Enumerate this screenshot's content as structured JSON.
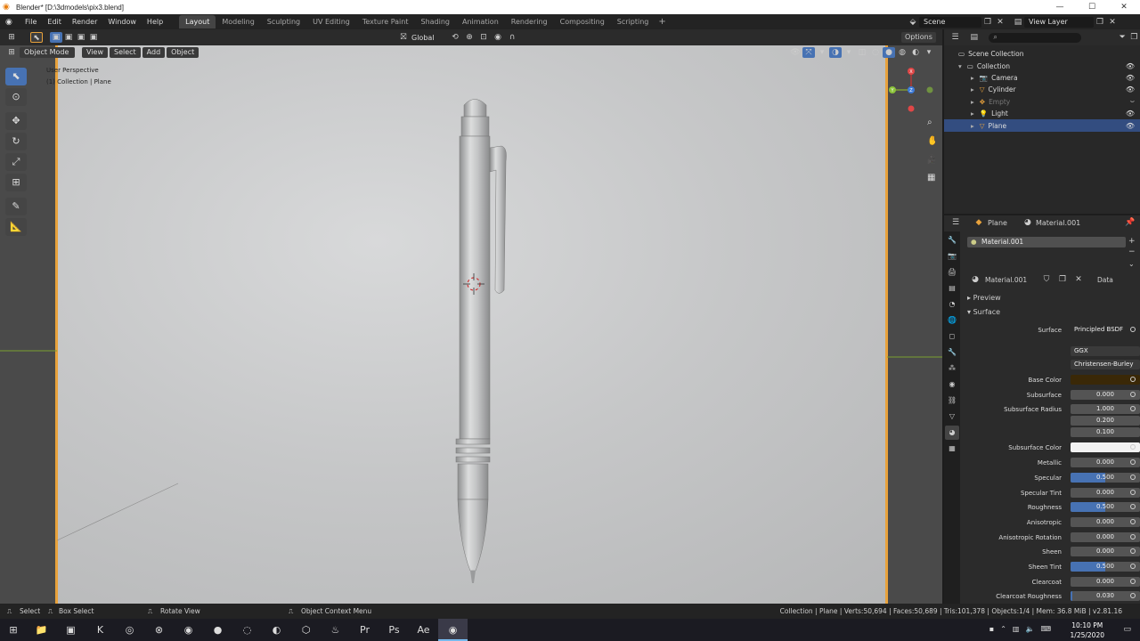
{
  "window": {
    "title": "Blender* [D:\\3dmodels\\pix3.blend]",
    "controls": [
      "—",
      "☐",
      "✕"
    ]
  },
  "menubar": {
    "items": [
      "File",
      "Edit",
      "Render",
      "Window",
      "Help"
    ],
    "workspaces": [
      "Layout",
      "Modeling",
      "Sculpting",
      "UV Editing",
      "Texture Paint",
      "Shading",
      "Animation",
      "Rendering",
      "Compositing",
      "Scripting"
    ],
    "active_workspace": "Layout",
    "scene": "Scene",
    "view_layer": "View Layer"
  },
  "header": {
    "transform_orientation": "Global",
    "options_label": "Options"
  },
  "viewport": {
    "mode": "Object Mode",
    "menus": [
      "View",
      "Select",
      "Add",
      "Object"
    ],
    "info_line1": "User Perspective",
    "info_line2": "(1) Collection | Plane",
    "gizmo_axes": {
      "x": "X",
      "y": "Y",
      "z": "Z"
    }
  },
  "outliner": {
    "root": "Scene Collection",
    "collection": "Collection",
    "objects": [
      {
        "name": "Camera",
        "selected": false,
        "dimmed": false
      },
      {
        "name": "Cylinder",
        "selected": false,
        "dimmed": false
      },
      {
        "name": "Empty",
        "selected": false,
        "dimmed": true
      },
      {
        "name": "Light",
        "selected": false,
        "dimmed": false
      },
      {
        "name": "Plane",
        "selected": true,
        "dimmed": false
      }
    ]
  },
  "properties": {
    "object": "Plane",
    "material": "Material.001",
    "slot_name": "Material.001",
    "link": "Data",
    "sections": {
      "preview": "Preview",
      "surface": "Surface"
    },
    "surface_label": "Surface",
    "surface_shader": "Principled BSDF",
    "distribution": "GGX",
    "subsurface_method": "Christensen-Burley",
    "colors": {
      "base_color": "#3a2807",
      "subsurface_color": "#f2f2f2",
      "accent": "#4772b3"
    },
    "fields": [
      {
        "label": "Base Color",
        "value": ""
      },
      {
        "label": "Subsurface",
        "value": "0.000",
        "fill": 0
      },
      {
        "label": "Subsurface Radius",
        "value": "1.000",
        "fill": 0
      },
      {
        "label": "",
        "value": "0.200",
        "fill": 0
      },
      {
        "label": "",
        "value": "0.100",
        "fill": 0
      },
      {
        "label": "Subsurface Color",
        "value": ""
      },
      {
        "label": "Metallic",
        "value": "0.000",
        "fill": 0
      },
      {
        "label": "Specular",
        "value": "0.500",
        "fill": 0.5
      },
      {
        "label": "Specular Tint",
        "value": "0.000",
        "fill": 0
      },
      {
        "label": "Roughness",
        "value": "0.500",
        "fill": 0.5
      },
      {
        "label": "Anisotropic",
        "value": "0.000",
        "fill": 0
      },
      {
        "label": "Anisotropic Rotation",
        "value": "0.000",
        "fill": 0
      },
      {
        "label": "Sheen",
        "value": "0.000",
        "fill": 0
      },
      {
        "label": "Sheen Tint",
        "value": "0.500",
        "fill": 0.5
      },
      {
        "label": "Clearcoat",
        "value": "0.000",
        "fill": 0
      },
      {
        "label": "Clearcoat Roughness",
        "value": "0.030",
        "fill": 0.03
      }
    ]
  },
  "statusbar": {
    "select": "Select",
    "box_select": "Box Select",
    "rotate_view": "Rotate View",
    "context_menu": "Object Context Menu",
    "stats": "Collection | Plane | Verts:50,694 | Faces:50,689 | Tris:101,378 | Objects:1/4 | Mem: 36.8 MiB | v2.81.16"
  },
  "taskbar": {
    "time": "10:10 PM",
    "date": "1/25/2020"
  }
}
